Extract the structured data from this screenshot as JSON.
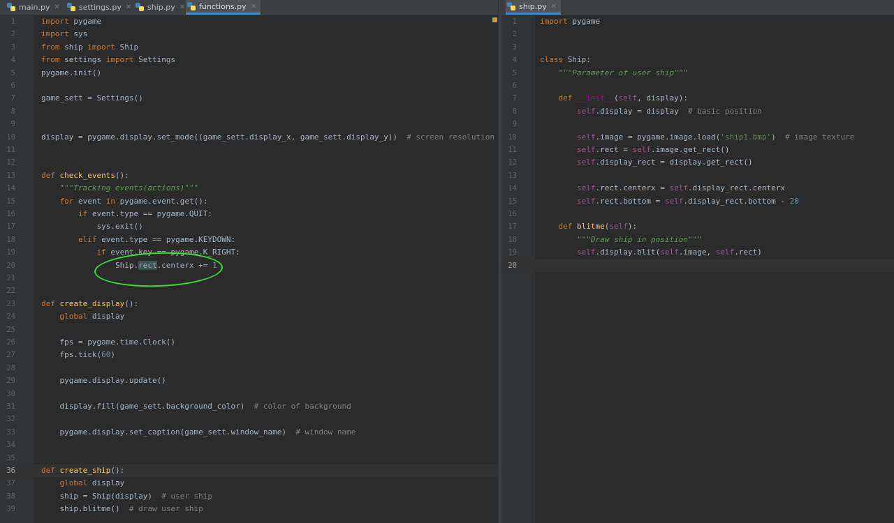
{
  "left_pane": {
    "tabs": [
      {
        "label": "main.py",
        "active": false
      },
      {
        "label": "settings.py",
        "active": false
      },
      {
        "label": "ship.py",
        "active": false
      },
      {
        "label": "functions.py",
        "active": true
      }
    ],
    "current_line": 36,
    "lines": [
      {
        "n": "1",
        "html": "<span class='k'>import</span> pygame"
      },
      {
        "n": "2",
        "html": "<span class='k'>import</span> sys"
      },
      {
        "n": "3",
        "html": "<span class='k'>from</span> ship <span class='k'>import</span> Ship"
      },
      {
        "n": "4",
        "html": "<span class='k'>from</span> settings <span class='k'>import</span> Settings"
      },
      {
        "n": "5",
        "html": "pygame.init()"
      },
      {
        "n": "6",
        "html": ""
      },
      {
        "n": "7",
        "html": "game_sett = Settings()"
      },
      {
        "n": "8",
        "html": ""
      },
      {
        "n": "9",
        "html": ""
      },
      {
        "n": "10",
        "html": "display = pygame.display.set_mode((game_sett.display_x, game_sett.display_y))  <span class='c'># screen resolution</span>"
      },
      {
        "n": "11",
        "html": ""
      },
      {
        "n": "12",
        "html": ""
      },
      {
        "n": "13",
        "html": "<span class='k'>def</span> <span class='fn'>check_events</span>():"
      },
      {
        "n": "14",
        "html": "    <span class='doc'>\"\"\"Tracking events(actions)\"\"\"</span>"
      },
      {
        "n": "15",
        "html": "    <span class='k'>for</span> event <span class='k'>in</span> pygame.event.get():"
      },
      {
        "n": "16",
        "html": "        <span class='k'>if</span> event.type == pygame.QUIT:"
      },
      {
        "n": "17",
        "html": "            sys.exit()"
      },
      {
        "n": "18",
        "html": "        <span class='k'>elif</span> event.type == pygame.KEYDOWN:"
      },
      {
        "n": "19",
        "html": "            <span class='k'>if</span> event.key == pygame.K_RIGHT:"
      },
      {
        "n": "20",
        "html": "                Ship.<span class='hl'>rect</span>.centerx += <span class='num'>1</span>"
      },
      {
        "n": "21",
        "html": ""
      },
      {
        "n": "22",
        "html": ""
      },
      {
        "n": "23",
        "html": "<span class='k'>def</span> <span class='fn'>create_display</span>():"
      },
      {
        "n": "24",
        "html": "    <span class='k'>global</span> display"
      },
      {
        "n": "25",
        "html": ""
      },
      {
        "n": "26",
        "html": "    fps = pygame.time.Clock()"
      },
      {
        "n": "27",
        "html": "    fps.tick(<span class='num'>60</span>)"
      },
      {
        "n": "28",
        "html": ""
      },
      {
        "n": "29",
        "html": "    pygame.display.update()"
      },
      {
        "n": "30",
        "html": ""
      },
      {
        "n": "31",
        "html": "    display.fill(game_sett.background_color)  <span class='c'># color of background</span>"
      },
      {
        "n": "32",
        "html": ""
      },
      {
        "n": "33",
        "html": "    pygame.display.set_caption(game_sett.window_name)  <span class='c'># window name</span>"
      },
      {
        "n": "34",
        "html": ""
      },
      {
        "n": "35",
        "html": ""
      },
      {
        "n": "36",
        "html": "<span class='k'>def</span> <span class='fn'>create_ship</span>():"
      },
      {
        "n": "37",
        "html": "    <span class='k'>global</span> display"
      },
      {
        "n": "38",
        "html": "    ship = Ship(display)  <span class='c'># user ship</span>"
      },
      {
        "n": "39",
        "html": "    ship.blitme()  <span class='c'># draw user ship</span>"
      }
    ]
  },
  "right_pane": {
    "tabs": [
      {
        "label": "ship.py",
        "active": true
      }
    ],
    "current_line": 20,
    "lines": [
      {
        "n": "1",
        "html": "<span class='k'>import</span> pygame"
      },
      {
        "n": "2",
        "html": ""
      },
      {
        "n": "3",
        "html": ""
      },
      {
        "n": "4",
        "html": "<span class='k'>class</span> Ship:"
      },
      {
        "n": "5",
        "html": "    <span class='doc'>\"\"\"Parameter of user ship\"\"\"</span>"
      },
      {
        "n": "6",
        "html": ""
      },
      {
        "n": "7",
        "html": "    <span class='k'>def</span> <span class='magic'>__init__</span>(<span class='selfkw'>self</span>, display):"
      },
      {
        "n": "8",
        "html": "        <span class='selfkw'>self</span>.display = display  <span class='c'># basic position</span>"
      },
      {
        "n": "9",
        "html": ""
      },
      {
        "n": "10",
        "html": "        <span class='selfkw'>self</span>.image = pygame.image.load(<span class='s'>'ship1.bmp'</span>)  <span class='c'># image texture</span>"
      },
      {
        "n": "11",
        "html": "        <span class='selfkw'>self</span>.rect = <span class='selfkw'>self</span>.image.get_rect()"
      },
      {
        "n": "12",
        "html": "        <span class='selfkw'>self</span>.display_rect = display.get_rect()"
      },
      {
        "n": "13",
        "html": ""
      },
      {
        "n": "14",
        "html": "        <span class='selfkw'>self</span>.rect.centerx = <span class='selfkw'>self</span>.display_rect.centerx"
      },
      {
        "n": "15",
        "html": "        <span class='selfkw'>self</span>.rect.bottom = <span class='selfkw'>self</span>.display_rect.bottom - <span class='num'>20</span>"
      },
      {
        "n": "16",
        "html": ""
      },
      {
        "n": "17",
        "html": "    <span class='k'>def</span> <span class='fn'>blitme</span>(<span class='selfkw'>self</span>):"
      },
      {
        "n": "18",
        "html": "        <span class='doc'>\"\"\"Draw ship in position\"\"\"</span>"
      },
      {
        "n": "19",
        "html": "        <span class='selfkw'>self</span>.display.blit(<span class='selfkw'>self</span>.image, <span class='selfkw'>self</span>.rect)"
      },
      {
        "n": "20",
        "html": ""
      }
    ]
  },
  "colors": {
    "background": "#2b2b2b",
    "gutter": "#313335",
    "keyword": "#cc7832",
    "annotation": "#3adf3a"
  }
}
